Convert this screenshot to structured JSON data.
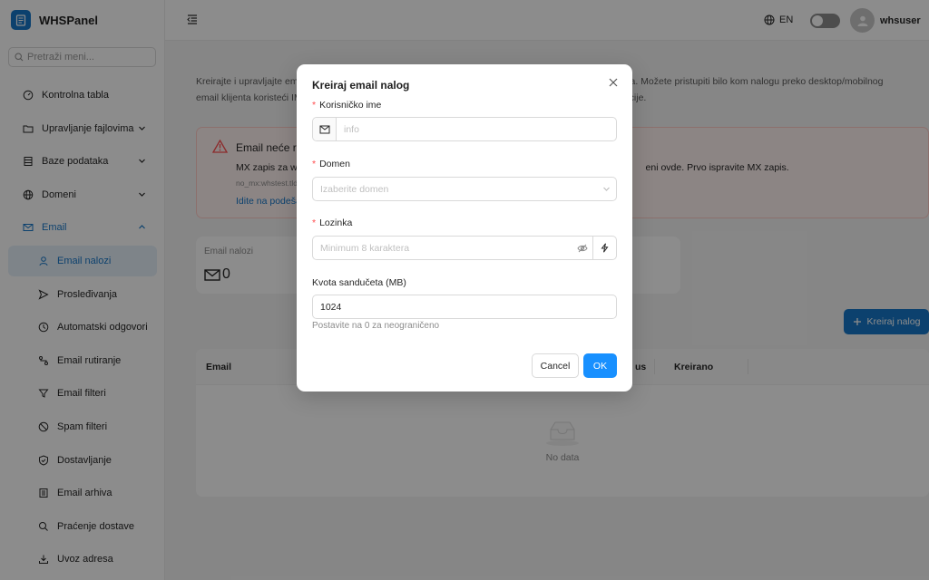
{
  "app": {
    "name": "WHSPanel"
  },
  "sidebar": {
    "search_placeholder": "Pretraži meni...",
    "items": [
      {
        "label": "Kontrolna tabla",
        "icon": "dashboard-icon"
      },
      {
        "label": "Upravljanje fajlovima",
        "icon": "folder-icon",
        "expandable": true
      },
      {
        "label": "Baze podataka",
        "icon": "database-icon",
        "expandable": true
      },
      {
        "label": "Domeni",
        "icon": "globe-icon",
        "expandable": true
      },
      {
        "label": "Email",
        "icon": "mail-icon",
        "expandable": true,
        "expanded": true
      }
    ],
    "email_subitems": [
      {
        "label": "Email nalozi",
        "icon": "user-icon",
        "active": true
      },
      {
        "label": "Prosleđivanja",
        "icon": "send-icon"
      },
      {
        "label": "Automatski odgovori",
        "icon": "clock-icon"
      },
      {
        "label": "Email rutiranje",
        "icon": "route-icon"
      },
      {
        "label": "Email filteri",
        "icon": "filter-icon"
      },
      {
        "label": "Spam filteri",
        "icon": "block-icon"
      },
      {
        "label": "Dostavljanje",
        "icon": "shield-icon"
      },
      {
        "label": "Email arhiva",
        "icon": "archive-icon"
      },
      {
        "label": "Praćenje dostave",
        "icon": "search-icon"
      },
      {
        "label": "Uvoz adresa",
        "icon": "import-icon"
      }
    ]
  },
  "header": {
    "language": "EN",
    "username": "whsuser"
  },
  "main": {
    "description_line1": "Kreirajte i upravljajte ema",
    "description_line1_right": "skladišta. Možete pristupiti bilo kom nalogu preko desktop/mobilnog",
    "description_line2": "email klijenta koristeći IM",
    "description_line2_right": "onfiguracije.",
    "alert": {
      "title": "Email neće ra",
      "text_left": "MX zapis za wh",
      "text_right": "eni ovde. Prvo ispravite MX zapis.",
      "sub": "no_mx:whstest.tld",
      "link": "Idite na podeša"
    },
    "stat": {
      "label": "Email nalozi",
      "value": "0"
    },
    "create_button": "Kreiraj nalog",
    "table": {
      "columns": [
        "Email",
        "us",
        "Kreirano"
      ],
      "empty_text": "No data"
    }
  },
  "modal": {
    "title": "Kreiraj email nalog",
    "username": {
      "label": "Korisničko ime",
      "placeholder": "info"
    },
    "domain": {
      "label": "Domen",
      "placeholder": "Izaberite domen"
    },
    "password": {
      "label": "Lozinka",
      "placeholder": "Minimum 8 karaktera"
    },
    "quota": {
      "label": "Kvota sandučeta (MB)",
      "value": "1024",
      "hint": "Postavite na 0 za neograničeno"
    },
    "cancel_label": "Cancel",
    "ok_label": "OK"
  },
  "colors": {
    "primary": "#1677c8",
    "ok_button": "#1890ff",
    "required": "#ff4d4f",
    "alert_border": "#ffccc7",
    "alert_bg": "#fff2f0"
  }
}
